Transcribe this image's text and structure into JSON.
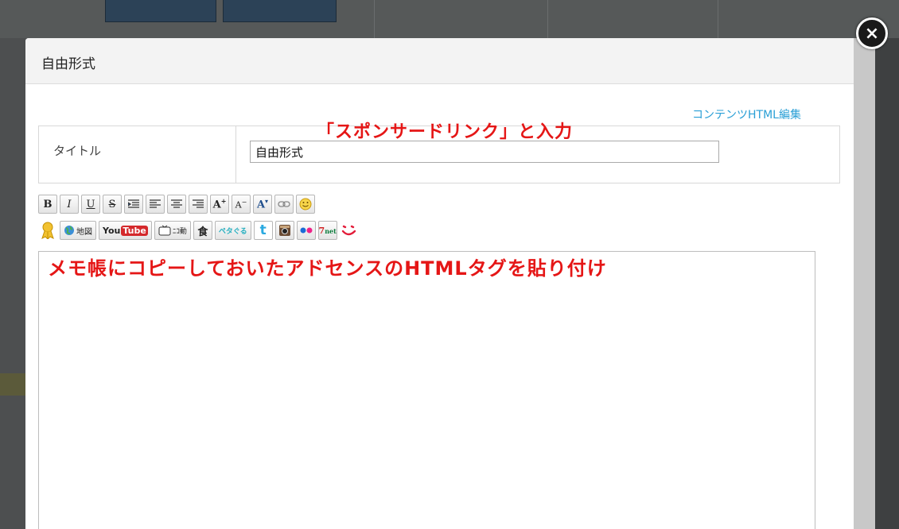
{
  "dialog": {
    "title": "自由形式",
    "html_edit_link": "コンテンツHTML編集",
    "close_label": "×"
  },
  "title_field": {
    "label": "タイトル",
    "value": "自由形式"
  },
  "toolbar_row1": [
    {
      "name": "bold-button",
      "glyph": "B"
    },
    {
      "name": "italic-button",
      "glyph": "I"
    },
    {
      "name": "underline-button",
      "glyph": "U"
    },
    {
      "name": "strikethrough-button",
      "glyph": "S"
    },
    {
      "name": "indent-button",
      "glyph": "indent-icon"
    },
    {
      "name": "align-left-button",
      "glyph": "align-left-icon"
    },
    {
      "name": "align-center-button",
      "glyph": "align-center-icon"
    },
    {
      "name": "align-right-button",
      "glyph": "align-right-icon"
    },
    {
      "name": "font-size-up-button",
      "glyph": "A⁺"
    },
    {
      "name": "font-size-down-button",
      "glyph": "A⁻"
    },
    {
      "name": "font-color-button",
      "glyph": "A˚"
    },
    {
      "name": "link-button",
      "glyph": "link-icon"
    },
    {
      "name": "emoji-button",
      "glyph": "smile-icon"
    }
  ],
  "toolbar_row2": {
    "map_label": "地図",
    "youtube_you": "You",
    "youtube_tube": "Tube",
    "nico_label": "ﾆｺ動",
    "pecopeco_label": "ペタぐる",
    "twitter_label": "t"
  },
  "annotations": {
    "title_hint": "「スポンサードリンク」と入力",
    "body_hint": "メモ帳にコピーしておいたアドセンスのHTMLタグを貼り付け"
  },
  "colors": {
    "annotation_red": "#e51616",
    "link_blue": "#2a9fd6"
  }
}
